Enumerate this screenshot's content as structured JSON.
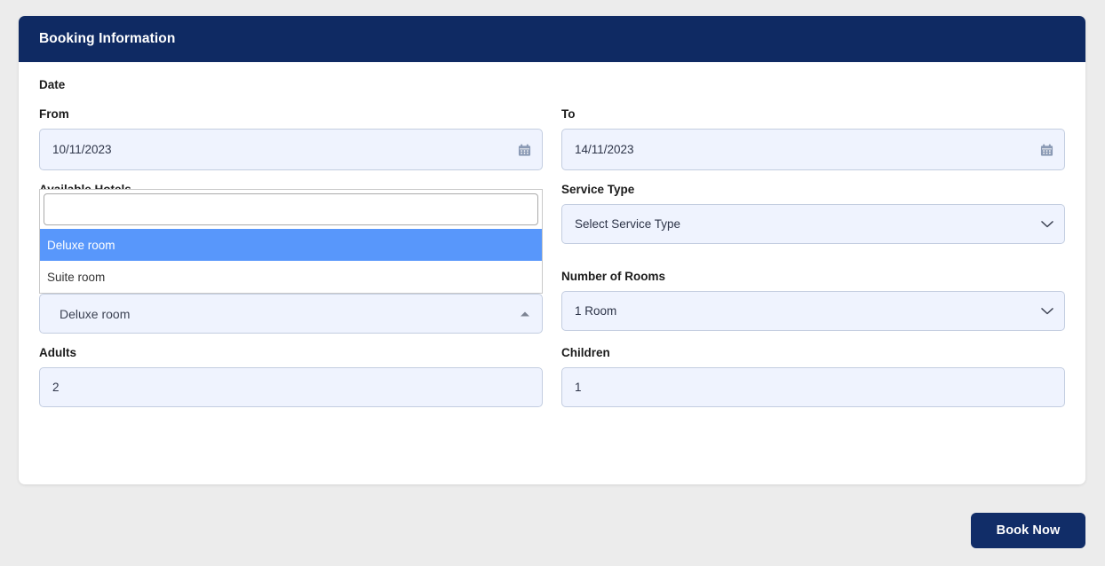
{
  "card": {
    "header_title": "Booking Information"
  },
  "form": {
    "date_section_title": "Date",
    "from": {
      "label": "From",
      "value": "10/11/2023",
      "icon": "calendar-icon"
    },
    "to": {
      "label": "To",
      "value": "14/11/2023",
      "icon": "calendar-icon"
    },
    "available_hotels": {
      "label": "Available Hotels",
      "selected_value": "Deluxe room",
      "search_value": "",
      "search_placeholder": "",
      "arrow_icon": "chevron-up-icon",
      "is_open": true,
      "options": [
        {
          "label": "Deluxe room",
          "highlighted": true
        },
        {
          "label": "Suite room",
          "highlighted": false
        }
      ]
    },
    "service_type": {
      "label": "Service Type",
      "value": "Select Service Type",
      "arrow_icon": "chevron-down-icon"
    },
    "number_of_rooms": {
      "label": "Number of Rooms",
      "value": "1 Room",
      "arrow_icon": "chevron-down-icon"
    },
    "adults": {
      "label": "Adults",
      "value": "2"
    },
    "children": {
      "label": "Children",
      "value": "1"
    }
  },
  "footer": {
    "book_now_label": "Book Now"
  },
  "colors": {
    "header_navy": "#0f2a63",
    "button_navy": "#112d68",
    "input_fill": "#eff3fe",
    "input_border": "#c3cde0",
    "highlight_blue": "#5897fb",
    "page_background": "#ececec"
  }
}
